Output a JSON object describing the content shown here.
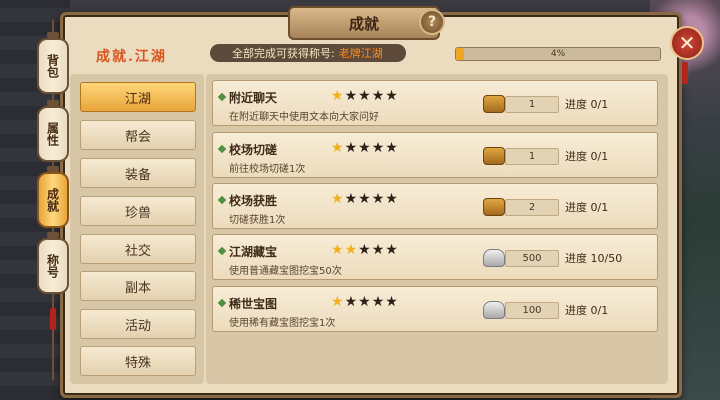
{
  "window": {
    "title": "成就",
    "help_label": "?",
    "close_label": "✕"
  },
  "side_tabs": [
    {
      "label": "背包",
      "active": false
    },
    {
      "label": "属性",
      "active": false
    },
    {
      "label": "成就",
      "active": true
    },
    {
      "label": "称号",
      "active": false
    }
  ],
  "header": {
    "heading": "成就.江湖",
    "reward_label": "全部完成可获得称号:",
    "reward_title": "老牌江湖",
    "progress": {
      "fraction": 0.04,
      "text": "4%"
    }
  },
  "categories": [
    {
      "label": "江湖",
      "active": true
    },
    {
      "label": "帮会",
      "active": false
    },
    {
      "label": "装备",
      "active": false
    },
    {
      "label": "珍兽",
      "active": false
    },
    {
      "label": "社交",
      "active": false
    },
    {
      "label": "副本",
      "active": false
    },
    {
      "label": "活动",
      "active": false
    },
    {
      "label": "特殊",
      "active": false
    }
  ],
  "achievements": [
    {
      "name": "附近聊天",
      "desc": "在附近聊天中使用文本向大家问好",
      "stars": 1,
      "max_stars": 5,
      "reward_icon": "treasure-chest-icon",
      "reward_value": "1",
      "progress": "进度 0/1"
    },
    {
      "name": "校场切磋",
      "desc": "前往校场切磋1次",
      "stars": 1,
      "max_stars": 5,
      "reward_icon": "treasure-chest-icon",
      "reward_value": "1",
      "progress": "进度 0/1"
    },
    {
      "name": "校场获胜",
      "desc": "切磋获胜1次",
      "stars": 1,
      "max_stars": 5,
      "reward_icon": "treasure-chest-icon",
      "reward_value": "2",
      "progress": "进度 0/1"
    },
    {
      "name": "江湖藏宝",
      "desc": "使用普通藏宝图挖宝50次",
      "stars": 2,
      "max_stars": 5,
      "reward_icon": "silver-ingot-icon",
      "reward_value": "500",
      "progress": "进度 10/50"
    },
    {
      "name": "稀世宝图",
      "desc": "使用稀有藏宝图挖宝1次",
      "stars": 1,
      "max_stars": 5,
      "reward_icon": "silver-ingot-icon",
      "reward_value": "100",
      "progress": "进度 0/1"
    }
  ],
  "colors": {
    "accent_orange": "#d9551e",
    "reward_title_color": "#ff8a1c",
    "star_on": "#f2b01c",
    "active_tab": "#ffd77a"
  }
}
